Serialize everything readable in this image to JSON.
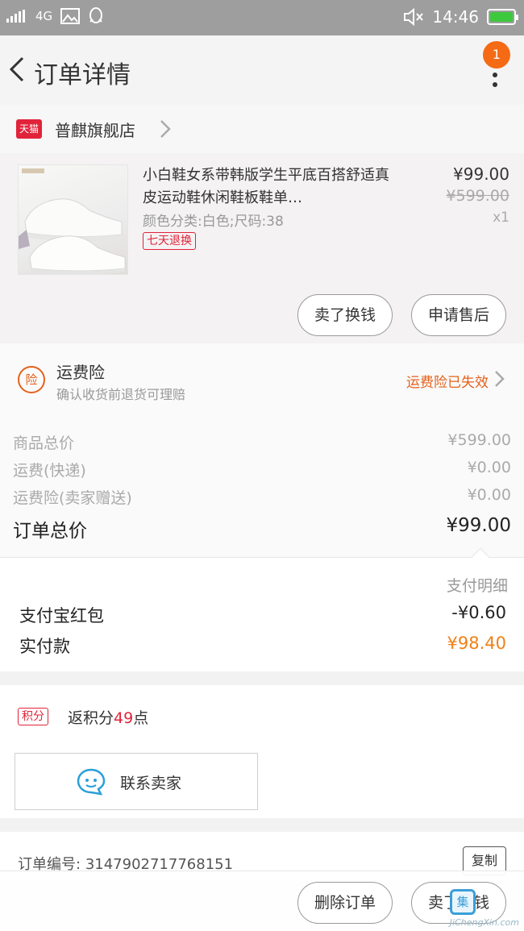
{
  "status_bar": {
    "network": "4G",
    "time": "14:46"
  },
  "header": {
    "title": "订单详情",
    "notification_count": "1"
  },
  "store": {
    "badge": "天猫",
    "name": "普麒旗舰店"
  },
  "product": {
    "title": "小白鞋女系带韩版学生平底百搭舒适真皮运动鞋休闲鞋板鞋单…",
    "spec": "颜色分类:白色;尺码:38",
    "return_tag": "七天退换",
    "price": "¥99.00",
    "original_price": "¥599.00",
    "quantity": "x1",
    "buttons": {
      "sell_exchange": "卖了换钱",
      "after_sales": "申请售后"
    }
  },
  "insurance": {
    "icon_label": "险",
    "title": "运费险",
    "subtitle": "确认收货前退货可理赔",
    "status": "运费险已失效"
  },
  "totals": {
    "rows": [
      {
        "label": "商品总价",
        "value": "¥599.00"
      },
      {
        "label": "运费(快递)",
        "value": "¥0.00"
      },
      {
        "label": "运费险(卖家赠送)",
        "value": "¥0.00"
      }
    ],
    "order_total_label": "订单总价",
    "order_total_value": "¥99.00"
  },
  "payment": {
    "detail_label": "支付明细",
    "redpacket_label": "支付宝红包",
    "redpacket_value": "-¥0.60",
    "paid_label": "实付款",
    "paid_value": "¥98.40"
  },
  "points": {
    "tag": "积分",
    "prefix": "返积分",
    "number": "49",
    "suffix": "点"
  },
  "contact": {
    "label": "联系卖家"
  },
  "order": {
    "number_label": "订单编号:",
    "number": "3147902717768151",
    "copy": "复制"
  },
  "bottom": {
    "delete": "删除订单",
    "sell": "卖了换钱"
  },
  "watermark": {
    "text": "JiChengXin.com",
    "mark": "集"
  },
  "colors": {
    "accent_orange": "#f08016",
    "tmall_red": "#e1233a",
    "insurance_orange": "#e5611b"
  }
}
